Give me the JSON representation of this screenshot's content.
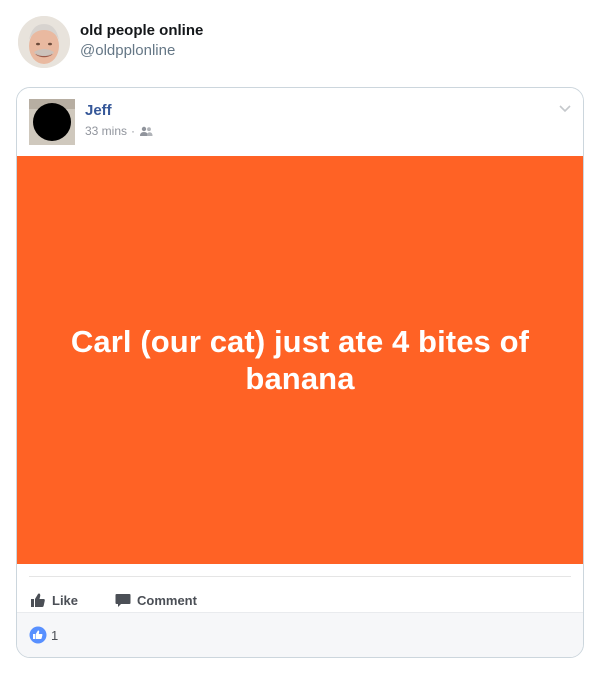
{
  "tweet": {
    "display_name": "old people online",
    "handle": "@oldpplonline"
  },
  "fb_post": {
    "author": "Jeff",
    "time": "33 mins",
    "separator": "·",
    "audience_icon": "friends-icon",
    "status_text": "Carl (our cat) just ate 4 bites of banana",
    "actions": {
      "like_label": "Like",
      "comment_label": "Comment"
    },
    "reaction_count": "1"
  },
  "colors": {
    "status_bg": "#ff6225",
    "fb_name": "#365899",
    "like_blue": "#5890ff",
    "meta_gray": "#90949c"
  }
}
